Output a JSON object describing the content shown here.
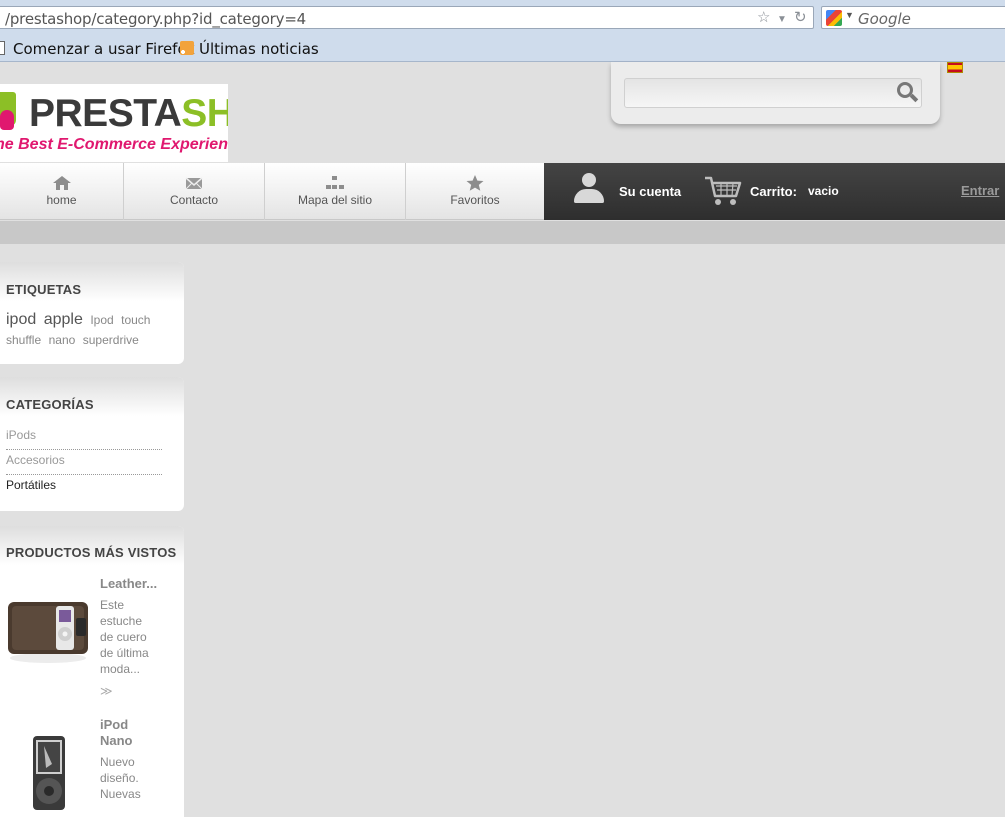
{
  "browser": {
    "url": "/prestashop/category.php?id_category=4",
    "search_placeholder": "Google",
    "bookmarks": [
      "Comenzar a usar Firefox",
      "Últimas noticias"
    ]
  },
  "header": {
    "logo_word_a": "PRESTA",
    "logo_word_b": "SHOP",
    "logo_tagline": "he Best E-Commerce Experience",
    "search_placeholder": ""
  },
  "nav": {
    "items": [
      {
        "label": "home",
        "icon": "home-icon"
      },
      {
        "label": "Contacto",
        "icon": "envelope-icon"
      },
      {
        "label": "Mapa del sitio",
        "icon": "sitemap-icon"
      },
      {
        "label": "Favoritos",
        "icon": "star-icon"
      }
    ],
    "account": "Su cuenta",
    "cart_label": "Carrito:",
    "cart_value": "vacio",
    "login": "Entrar"
  },
  "sidebar": {
    "tags": {
      "title": "ETIQUETAS",
      "items": [
        "ipod",
        "apple",
        "Ipod",
        "touch",
        "shuffle",
        "nano",
        "superdrive"
      ]
    },
    "categories": {
      "title": "CATEGORÍAS",
      "items": [
        "iPods",
        "Accesorios",
        "Portátiles"
      ]
    },
    "viewed": {
      "title": "PRODUCTOS MÁS VISTOS",
      "products": [
        {
          "name": "Leather...",
          "desc_lines": [
            "Este",
            "estuche",
            "de cuero",
            "de última",
            "moda..."
          ],
          "more": "≫"
        },
        {
          "name_lines": [
            "iPod",
            "Nano"
          ],
          "desc_lines": [
            "Nuevo",
            "diseño.",
            "Nuevas"
          ]
        }
      ]
    }
  },
  "colors": {
    "brand_green": "#8cbf26",
    "brand_pink": "#e0186f",
    "nav_dark": "#333333",
    "page_bg": "#e0e0e0"
  }
}
